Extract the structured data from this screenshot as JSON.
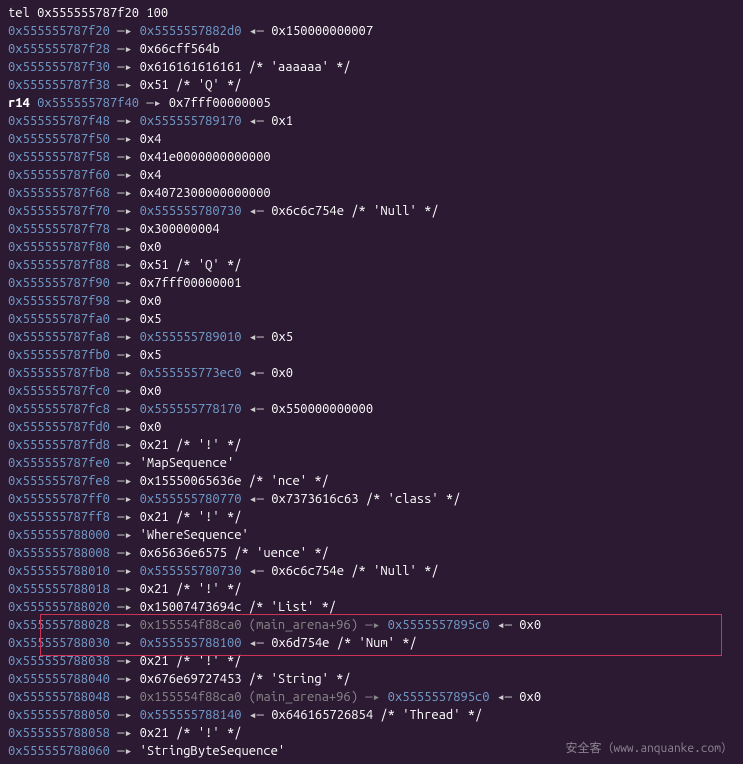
{
  "command": "tel 0x555555787f20 100",
  "arrows": {
    "right": "—▸",
    "left": "◂—"
  },
  "watermark": "安全客（www.anquanke.com）",
  "highlight": {
    "start_index": 34,
    "end_index": 35
  },
  "lines": [
    {
      "prefix": {
        "type": "cmd"
      },
      "text": "tel 0x555555787f20 100"
    },
    {
      "addr": "0x555555787f20",
      "chain": [
        {
          "t": "ptr",
          "v": "0x5555557882d0"
        },
        {
          "t": "val",
          "v": "0x150000000007"
        }
      ]
    },
    {
      "addr": "0x555555787f28",
      "chain": [
        {
          "t": "val",
          "v": "0x66cff564b"
        }
      ]
    },
    {
      "addr": "0x555555787f30",
      "chain": [
        {
          "t": "val",
          "v": "0x616161616161 /* 'aaaaaa' */"
        }
      ]
    },
    {
      "addr": "0x555555787f38",
      "chain": [
        {
          "t": "val",
          "v": "0x51 /* 'Q' */"
        }
      ]
    },
    {
      "prefix": {
        "type": "reg",
        "v": "r14"
      },
      "addr": "0x555555787f40",
      "chain": [
        {
          "t": "val",
          "v": "0x7fff00000005"
        }
      ]
    },
    {
      "addr": "0x555555787f48",
      "chain": [
        {
          "t": "ptr",
          "v": "0x555555789170"
        },
        {
          "t": "val",
          "v": "0x1"
        }
      ]
    },
    {
      "addr": "0x555555787f50",
      "chain": [
        {
          "t": "val",
          "v": "0x4"
        }
      ]
    },
    {
      "addr": "0x555555787f58",
      "chain": [
        {
          "t": "val",
          "v": "0x41e0000000000000"
        }
      ]
    },
    {
      "addr": "0x555555787f60",
      "chain": [
        {
          "t": "val",
          "v": "0x4"
        }
      ]
    },
    {
      "addr": "0x555555787f68",
      "chain": [
        {
          "t": "val",
          "v": "0x4072300000000000"
        }
      ]
    },
    {
      "addr": "0x555555787f70",
      "chain": [
        {
          "t": "ptr",
          "v": "0x555555780730"
        },
        {
          "t": "val",
          "v": "0x6c6c754e /* 'Null' */"
        }
      ]
    },
    {
      "addr": "0x555555787f78",
      "chain": [
        {
          "t": "val",
          "v": "0x300000004"
        }
      ]
    },
    {
      "addr": "0x555555787f80",
      "chain": [
        {
          "t": "val",
          "v": "0x0"
        }
      ]
    },
    {
      "addr": "0x555555787f88",
      "chain": [
        {
          "t": "val",
          "v": "0x51 /* 'Q' */"
        }
      ]
    },
    {
      "addr": "0x555555787f90",
      "chain": [
        {
          "t": "val",
          "v": "0x7fff00000001"
        }
      ]
    },
    {
      "addr": "0x555555787f98",
      "chain": [
        {
          "t": "val",
          "v": "0x0"
        }
      ]
    },
    {
      "addr": "0x555555787fa0",
      "chain": [
        {
          "t": "val",
          "v": "0x5"
        }
      ]
    },
    {
      "addr": "0x555555787fa8",
      "chain": [
        {
          "t": "ptr",
          "v": "0x555555789010"
        },
        {
          "t": "val",
          "v": "0x5"
        }
      ]
    },
    {
      "addr": "0x555555787fb0",
      "chain": [
        {
          "t": "val",
          "v": "0x5"
        }
      ]
    },
    {
      "addr": "0x555555787fb8",
      "chain": [
        {
          "t": "ptr",
          "v": "0x555555773ec0"
        },
        {
          "t": "val",
          "v": "0x0"
        }
      ]
    },
    {
      "addr": "0x555555787fc0",
      "chain": [
        {
          "t": "val",
          "v": "0x0"
        }
      ]
    },
    {
      "addr": "0x555555787fc8",
      "chain": [
        {
          "t": "ptr",
          "v": "0x555555778170"
        },
        {
          "t": "val",
          "v": "0x550000000000"
        }
      ]
    },
    {
      "addr": "0x555555787fd0",
      "chain": [
        {
          "t": "val",
          "v": "0x0"
        }
      ]
    },
    {
      "addr": "0x555555787fd8",
      "chain": [
        {
          "t": "val",
          "v": "0x21 /* '!' */"
        }
      ]
    },
    {
      "addr": "0x555555787fe0",
      "chain": [
        {
          "t": "str",
          "v": "'MapSequence'"
        }
      ]
    },
    {
      "addr": "0x555555787fe8",
      "chain": [
        {
          "t": "val",
          "v": "0x15550065636e /* 'nce' */"
        }
      ]
    },
    {
      "addr": "0x555555787ff0",
      "chain": [
        {
          "t": "ptr",
          "v": "0x555555780770"
        },
        {
          "t": "val",
          "v": "0x7373616c63 /* 'class' */"
        }
      ]
    },
    {
      "addr": "0x555555787ff8",
      "chain": [
        {
          "t": "val",
          "v": "0x21 /* '!' */"
        }
      ]
    },
    {
      "addr": "0x555555788000",
      "chain": [
        {
          "t": "str",
          "v": "'WhereSequence'"
        }
      ]
    },
    {
      "addr": "0x555555788008",
      "chain": [
        {
          "t": "val",
          "v": "0x65636e6575 /* 'uence' */"
        }
      ]
    },
    {
      "addr": "0x555555788010",
      "chain": [
        {
          "t": "ptr",
          "v": "0x555555780730"
        },
        {
          "t": "val",
          "v": "0x6c6c754e /* 'Null' */"
        }
      ]
    },
    {
      "addr": "0x555555788018",
      "chain": [
        {
          "t": "val",
          "v": "0x21 /* '!' */"
        }
      ]
    },
    {
      "addr": "0x555555788020",
      "chain": [
        {
          "t": "val",
          "v": "0x15007473694c /* 'List' */"
        }
      ]
    },
    {
      "addr": "0x555555788028",
      "chain": [
        {
          "t": "dim",
          "v": "0x155554f88ca0 (main_arena+96)"
        },
        {
          "t": "dimarrow",
          "v": "—▸"
        },
        {
          "t": "ptr",
          "v": "0x5555557895c0"
        },
        {
          "t": "val",
          "v": "0x0"
        }
      ]
    },
    {
      "addr": "0x555555788030",
      "chain": [
        {
          "t": "ptr",
          "v": "0x555555788100"
        },
        {
          "t": "val",
          "v": "0x6d754e /* 'Num' */"
        }
      ]
    },
    {
      "addr": "0x555555788038",
      "chain": [
        {
          "t": "val",
          "v": "0x21 /* '!' */"
        }
      ]
    },
    {
      "addr": "0x555555788040",
      "chain": [
        {
          "t": "val",
          "v": "0x676e69727453 /* 'String' */"
        }
      ]
    },
    {
      "addr": "0x555555788048",
      "chain": [
        {
          "t": "dim",
          "v": "0x155554f88ca0 (main_arena+96)"
        },
        {
          "t": "dimarrow",
          "v": "—▸"
        },
        {
          "t": "ptr",
          "v": "0x5555557895c0"
        },
        {
          "t": "val",
          "v": "0x0"
        }
      ]
    },
    {
      "addr": "0x555555788050",
      "chain": [
        {
          "t": "ptr",
          "v": "0x555555788140"
        },
        {
          "t": "val",
          "v": "0x646165726854 /* 'Thread' */"
        }
      ]
    },
    {
      "addr": "0x555555788058",
      "chain": [
        {
          "t": "val",
          "v": "0x21 /* '!' */"
        }
      ]
    },
    {
      "addr": "0x555555788060",
      "chain": [
        {
          "t": "str",
          "v": "'StringByteSequence'"
        }
      ]
    }
  ]
}
